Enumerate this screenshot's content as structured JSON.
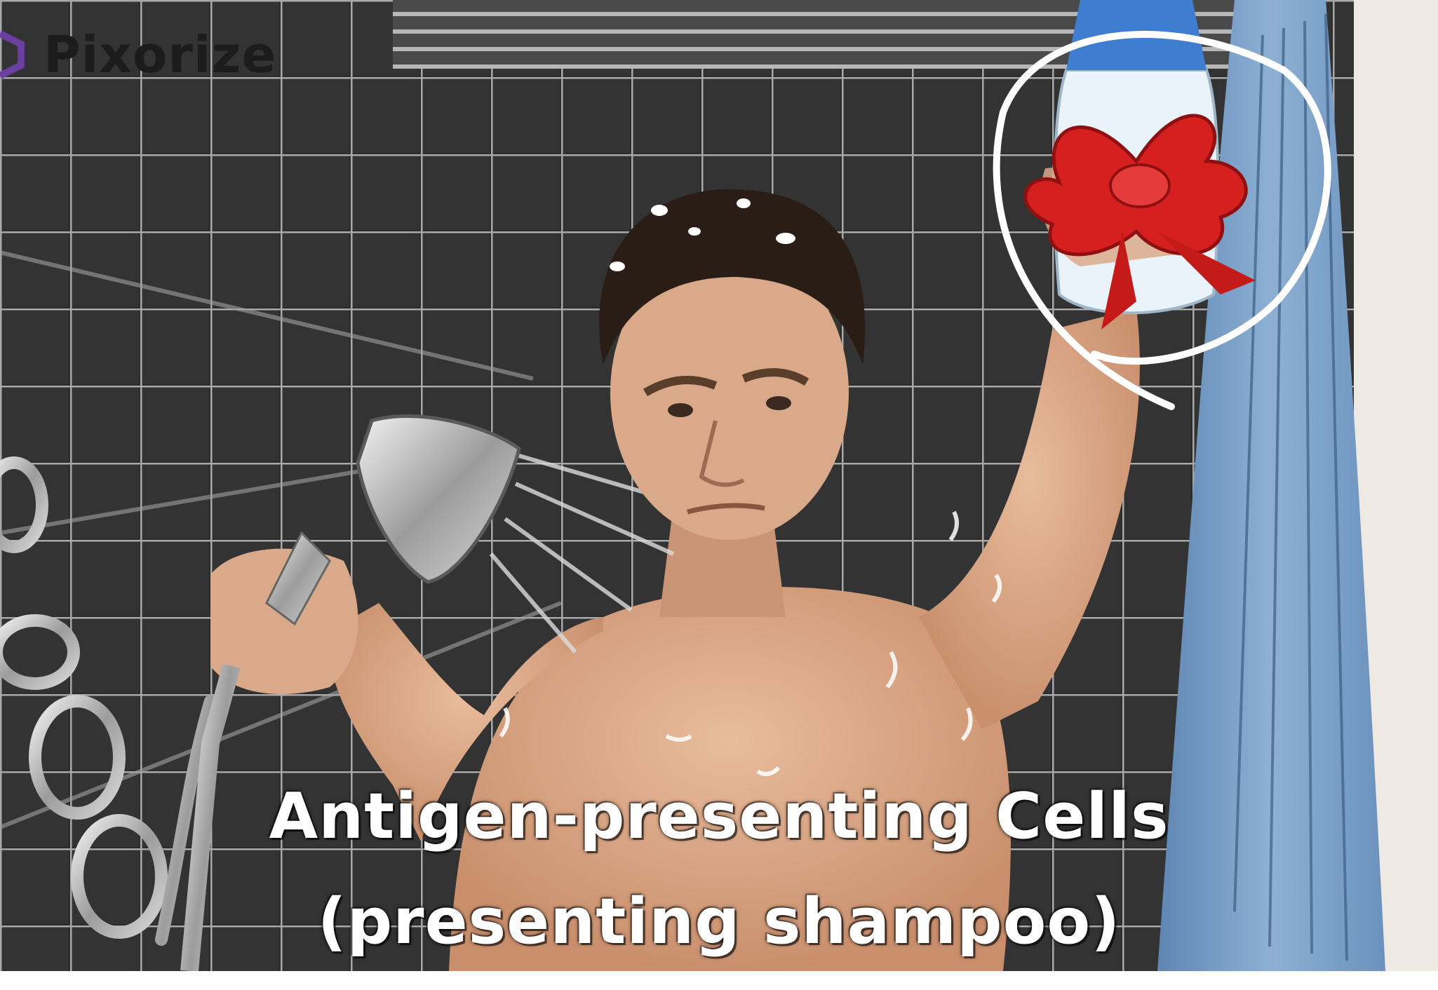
{
  "brand": {
    "name": "Pixorize",
    "logo_icon": "pixorize-hexagon-icon"
  },
  "caption": {
    "line1": "Antigen-presenting Cells",
    "line2": "(presenting shampoo)"
  },
  "colors": {
    "tile": "#2b2b2b",
    "grout": "#a9a9a9",
    "skin": "#d9a98a",
    "hair": "#2a1d16",
    "curtain": "#7fa4c9",
    "bow": "#d62020",
    "bottle": "#e9f3f9",
    "circle_annotation": "#ffffff",
    "caption_text": "#ffffff",
    "logo_accent": "#6a3fa0"
  }
}
